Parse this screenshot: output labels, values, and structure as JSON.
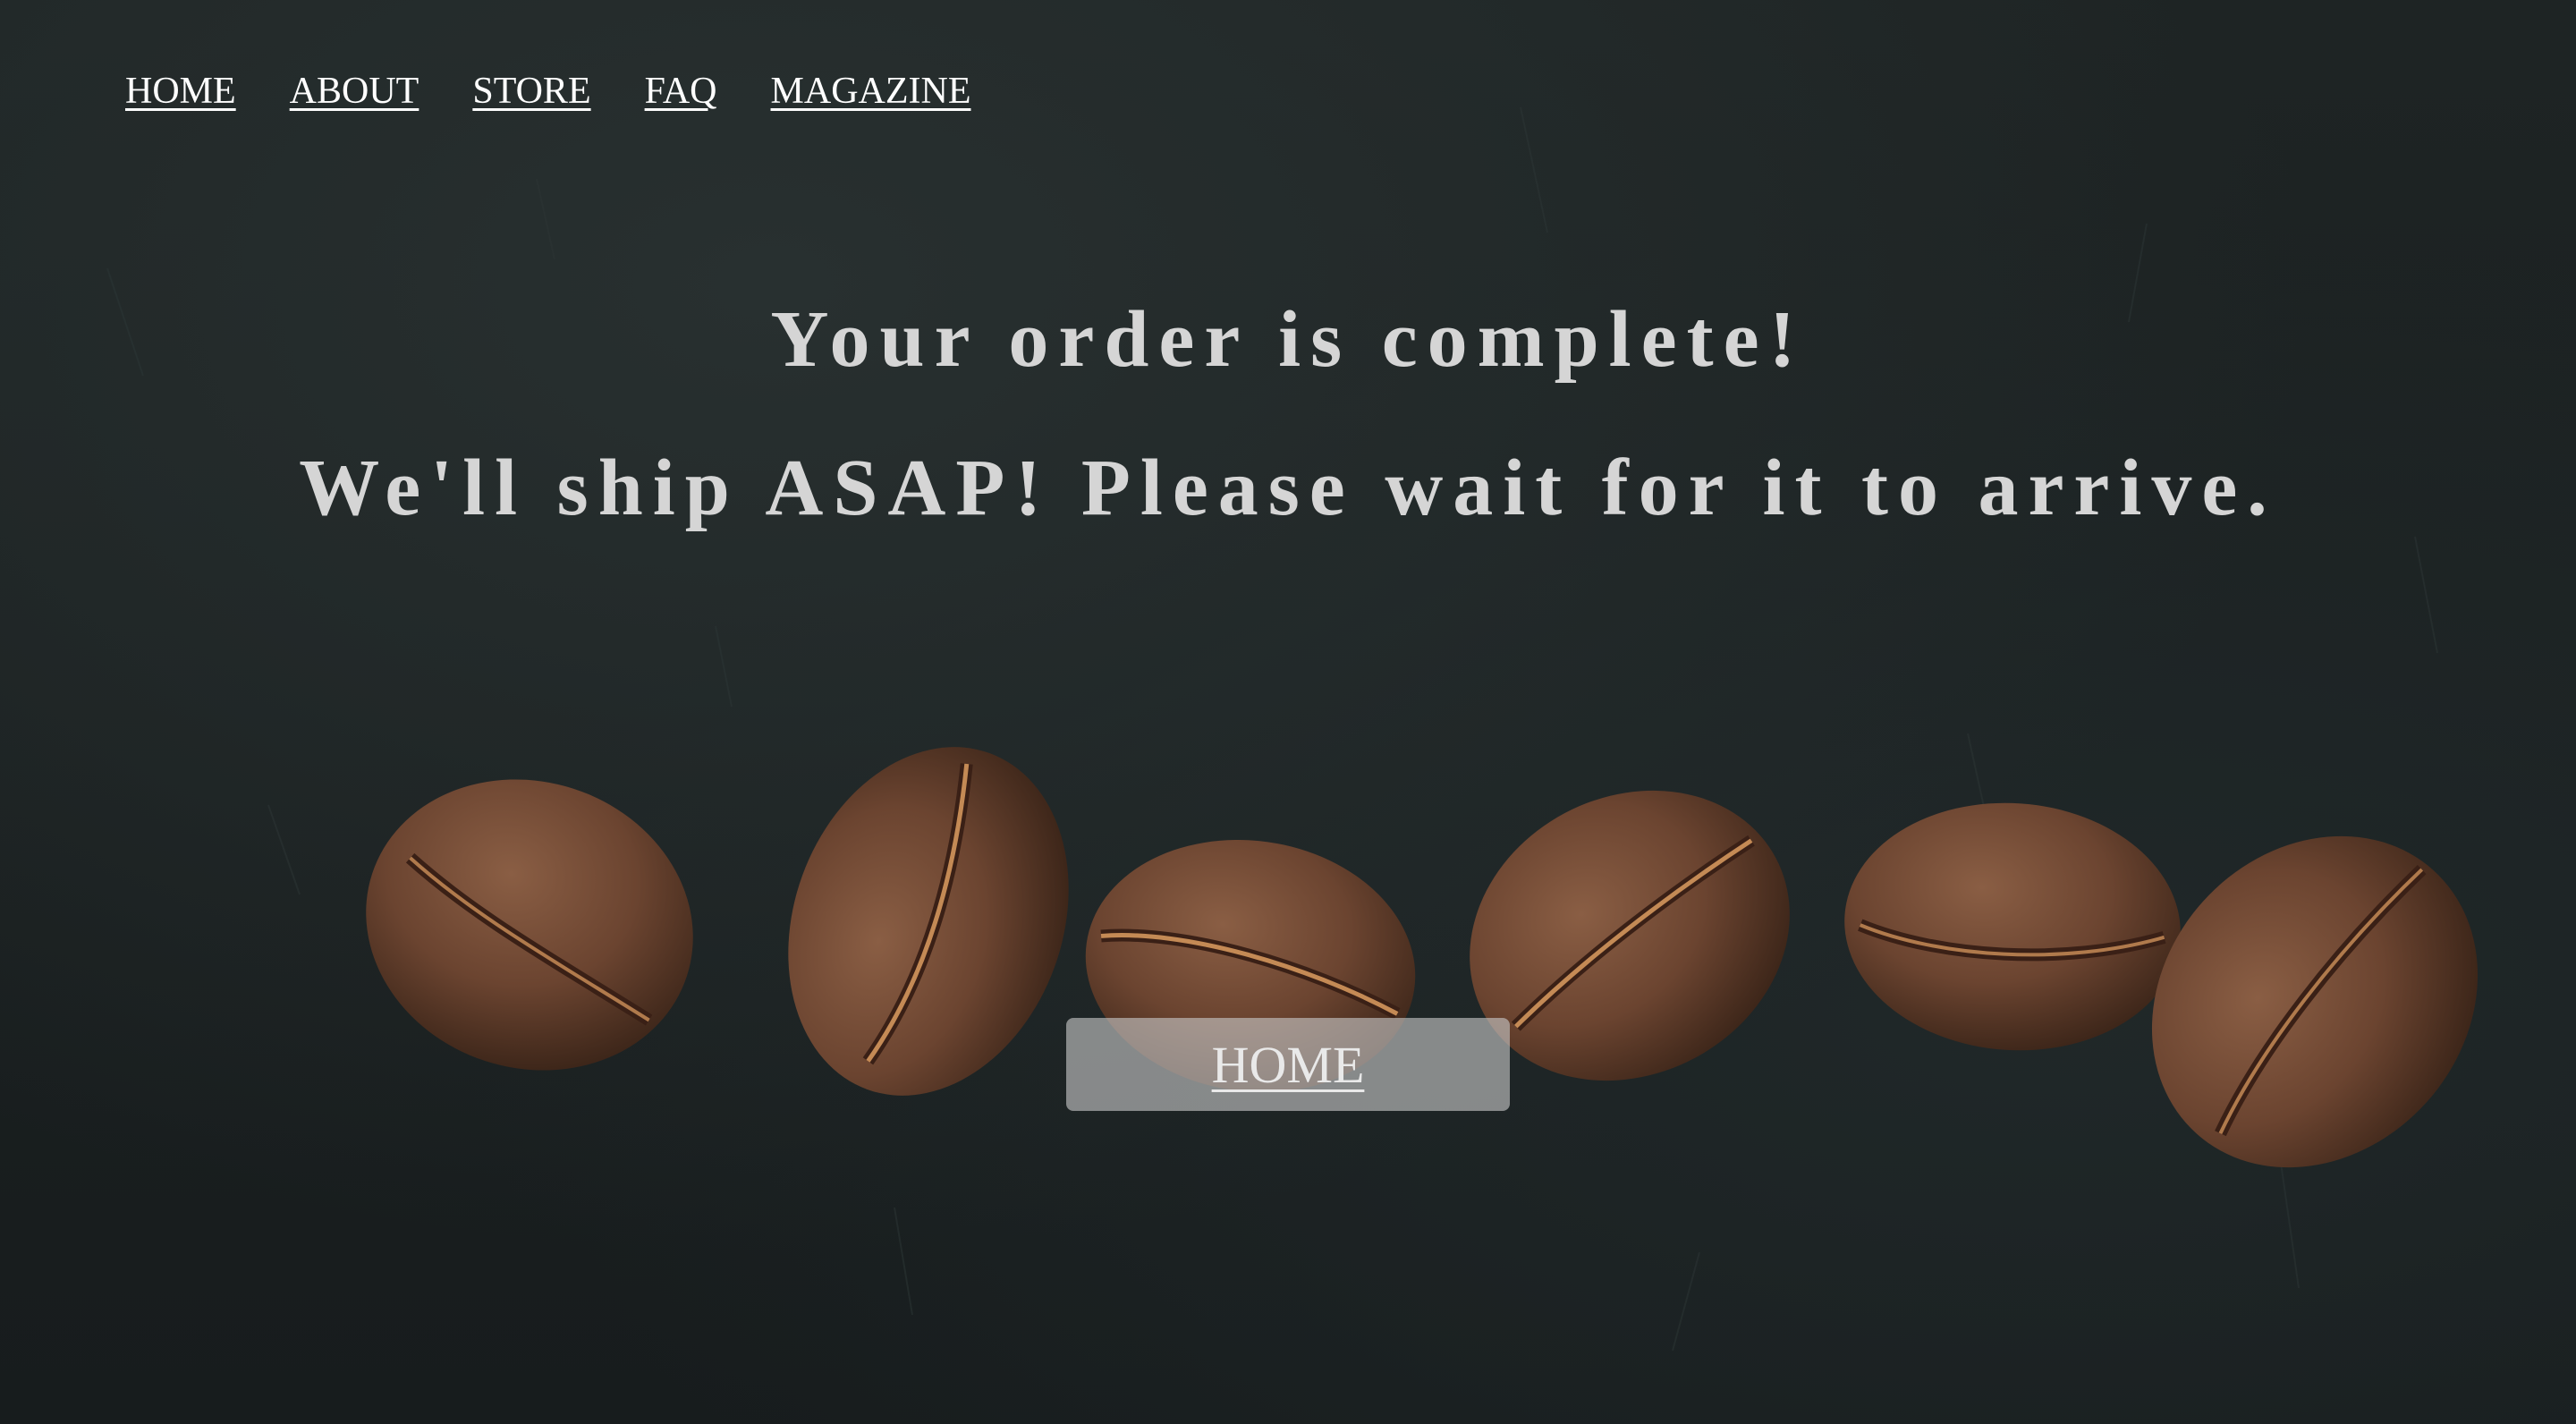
{
  "nav": {
    "items": [
      {
        "label": "HOME"
      },
      {
        "label": "ABOUT"
      },
      {
        "label": "STORE"
      },
      {
        "label": "FAQ"
      },
      {
        "label": "MAGAZINE"
      }
    ]
  },
  "hero": {
    "line1": "Your order is complete!",
    "line2": "We'll ship ASAP! Please wait for it to arrive."
  },
  "button": {
    "label": "HOME"
  },
  "colors": {
    "background": "#1a1f20",
    "heading_text": "#d5d5d5",
    "nav_text": "#ffffff",
    "button_bg": "#c8c8c8",
    "bean": "#6b4430"
  },
  "background_image": "coffee-beans-photo"
}
